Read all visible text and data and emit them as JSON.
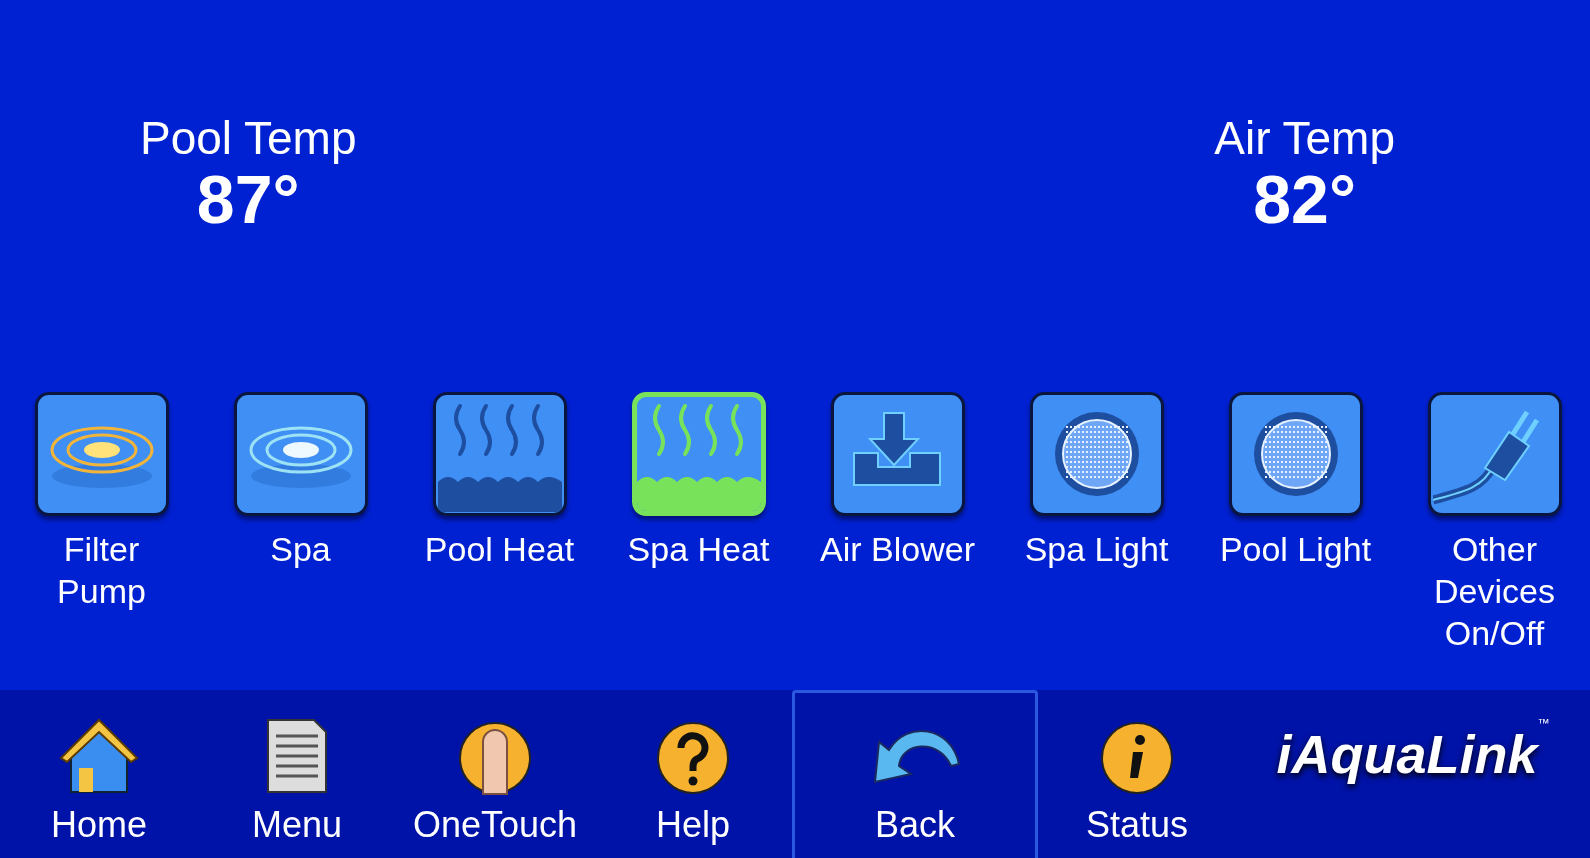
{
  "temperatures": [
    {
      "label": "Pool Temp",
      "value": "87°"
    },
    {
      "label": "Air Temp",
      "value": "82°"
    }
  ],
  "devices": [
    {
      "kind": "filter_pump",
      "label": "Filter Pump",
      "on": false
    },
    {
      "kind": "spa",
      "label": "Spa",
      "on": false
    },
    {
      "kind": "pool_heat",
      "label": "Pool Heat",
      "on": false
    },
    {
      "kind": "spa_heat",
      "label": "Spa Heat",
      "on": true
    },
    {
      "kind": "air_blower",
      "label": "Air Blower",
      "on": false
    },
    {
      "kind": "light",
      "label": "Spa Light",
      "on": false
    },
    {
      "kind": "light",
      "label": "Pool Light",
      "on": false
    },
    {
      "kind": "plug",
      "label": "Other Devices On/Off",
      "on": false
    }
  ],
  "nav": [
    {
      "kind": "home",
      "label": "Home",
      "selected": false
    },
    {
      "kind": "menu",
      "label": "Menu",
      "selected": false
    },
    {
      "kind": "onetouch",
      "label": "OneTouch",
      "selected": false
    },
    {
      "kind": "help",
      "label": "Help",
      "selected": false
    },
    {
      "kind": "back",
      "label": "Back",
      "selected": true
    },
    {
      "kind": "status",
      "label": "Status",
      "selected": false
    }
  ],
  "logo": {
    "text": "iAquaLink",
    "mark": "™"
  }
}
